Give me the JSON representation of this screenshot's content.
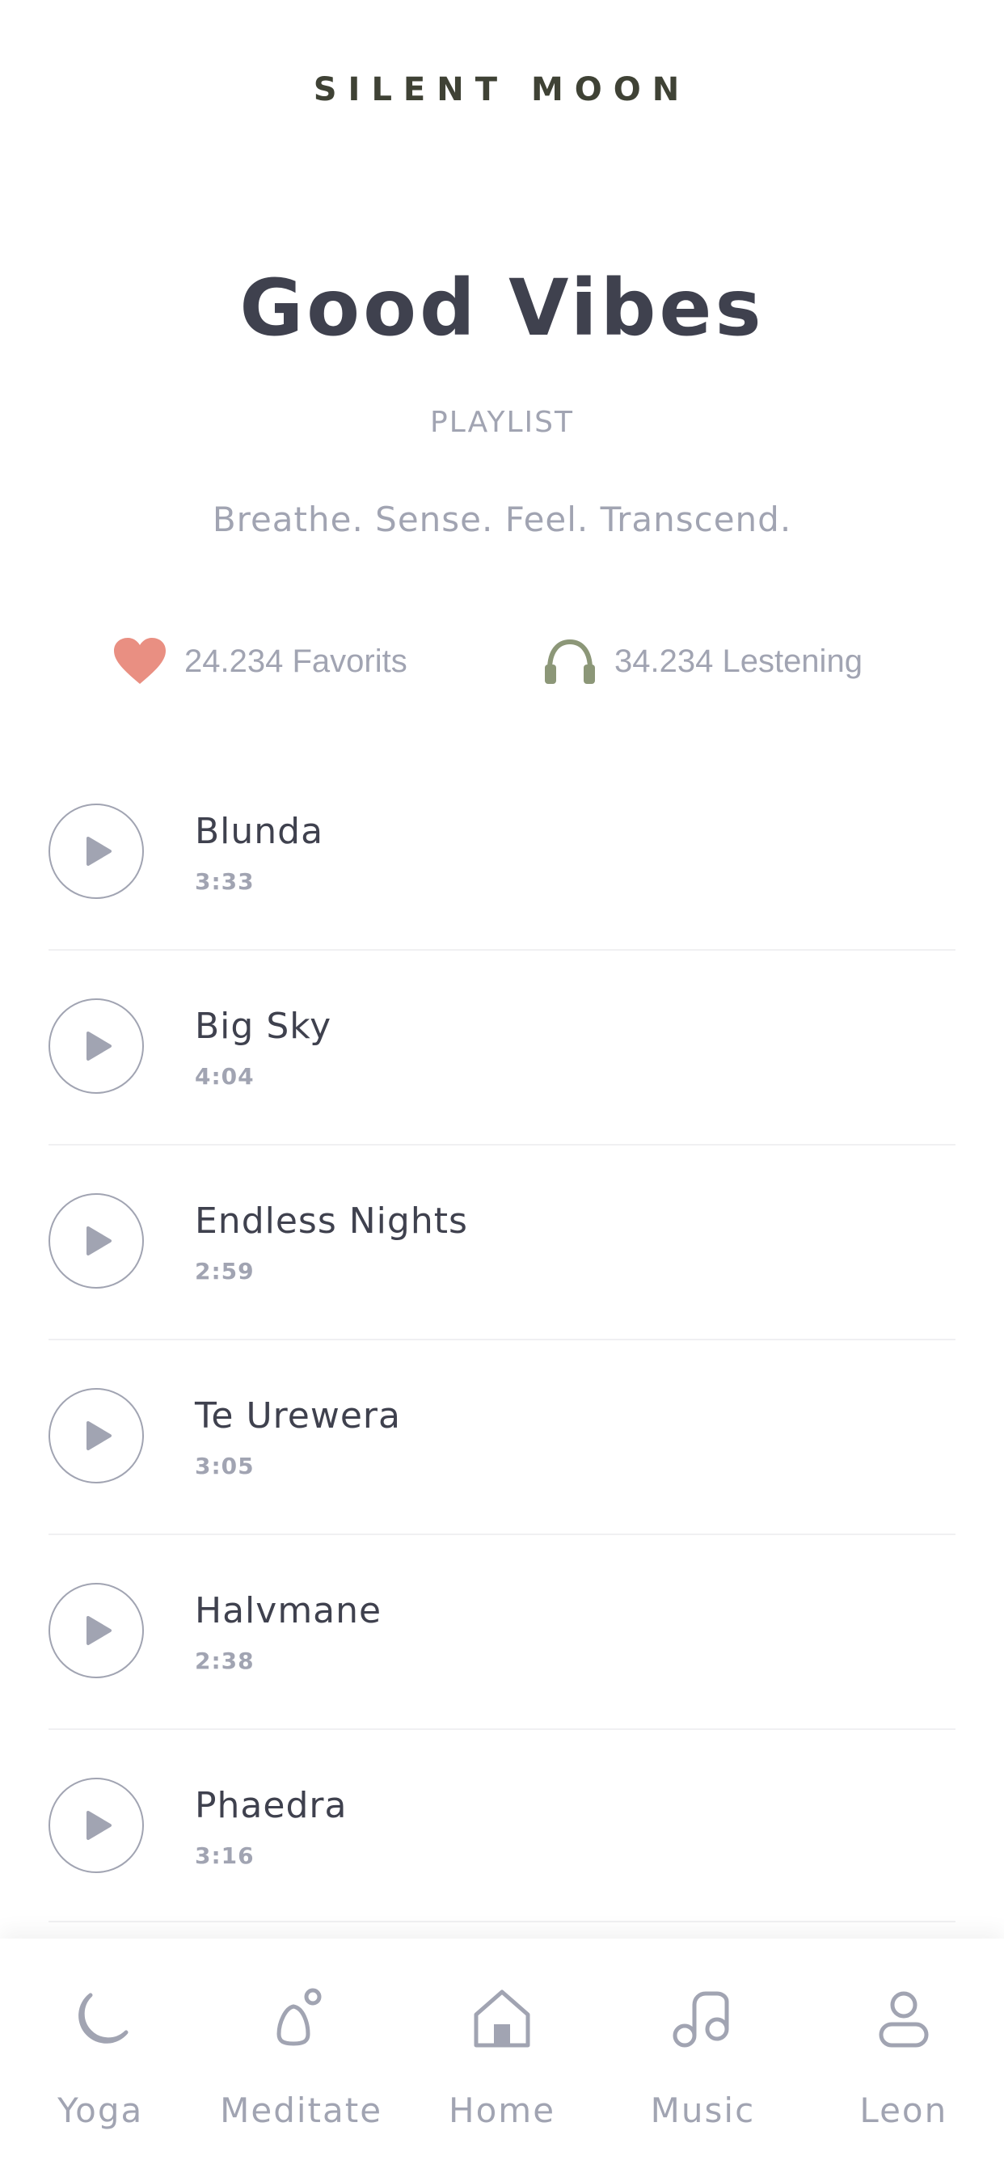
{
  "header": {
    "brand": "SILENT  MOON"
  },
  "playlist": {
    "title": "Good Vibes",
    "subtitle": "PLAYLIST",
    "tagline": "Breathe. Sense. Feel. Transcend."
  },
  "stats": {
    "favorites": {
      "icon": "heart-icon",
      "label": "24.234 Favorits",
      "color": "#e98f82"
    },
    "listening": {
      "icon": "headphones-icon",
      "label": "34.234 Lestening",
      "color": "#8c9778"
    }
  },
  "tracks": [
    {
      "name": "Blunda",
      "duration": "3:33"
    },
    {
      "name": "Big Sky",
      "duration": "4:04"
    },
    {
      "name": "Endless Nights",
      "duration": "2:59"
    },
    {
      "name": "Te Urewera",
      "duration": "3:05"
    },
    {
      "name": "Halvmane",
      "duration": "2:38"
    },
    {
      "name": "Phaedra",
      "duration": "3:16"
    }
  ],
  "tabs": [
    {
      "label": "Yoga",
      "icon": "moon-icon"
    },
    {
      "label": "Meditate",
      "icon": "meditate-icon"
    },
    {
      "label": "Home",
      "icon": "home-icon"
    },
    {
      "label": "Music",
      "icon": "music-note-icon"
    },
    {
      "label": "Leon",
      "icon": "user-icon"
    }
  ],
  "colors": {
    "text_dark": "#3f414e",
    "text_muted": "#a1a4b2",
    "brand_dark": "#3f4235"
  }
}
